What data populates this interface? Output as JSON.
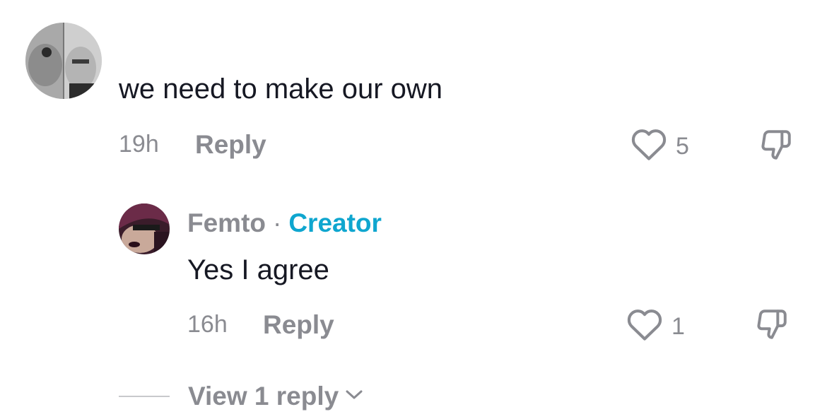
{
  "comment": {
    "text": "we need to make our own",
    "time": "19h",
    "reply_label": "Reply",
    "likes": "5"
  },
  "reply": {
    "username": "Femto",
    "separator": "·",
    "badge": "Creator",
    "text": "Yes I agree",
    "time": "16h",
    "reply_label": "Reply",
    "likes": "1"
  },
  "view_replies": {
    "label": "View 1 reply"
  },
  "icons": {
    "like": "heart-outline-icon",
    "dislike": "thumbs-down-icon",
    "expand": "chevron-down-icon"
  },
  "colors": {
    "text": "#161823",
    "secondary": "#8a8b91",
    "creator_badge": "#0fa6cf"
  }
}
